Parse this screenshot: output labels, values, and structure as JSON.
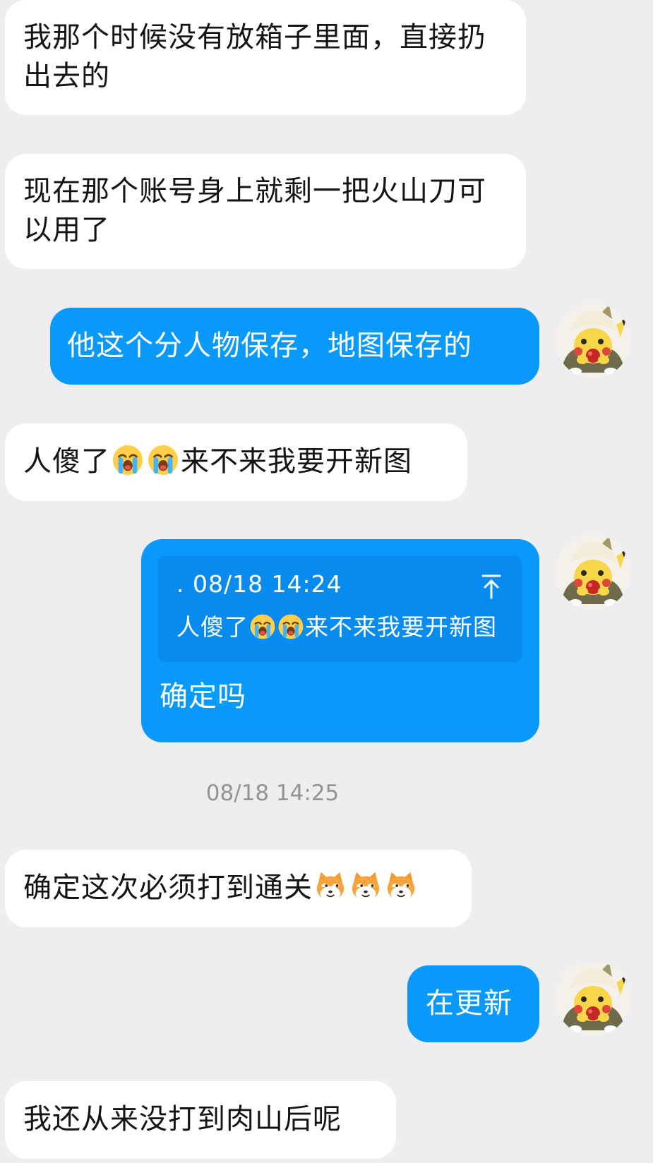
{
  "messages": {
    "m1": "我那个时候没有放箱子里面，直接扔出去的",
    "m2": "现在那个账号身上就剩一把火山刀可以用了",
    "m3": "他这个分人物保存，地图保存的",
    "m4_a": "人傻了",
    "m4_b": "来不来我要开新图",
    "m5_quote_meta": ". 08/18 14:24",
    "m5_quote_a": "人傻了",
    "m5_quote_b": "来不来我要开新图",
    "m5_reply": "确定吗",
    "m6": "确定这次必须打到通关",
    "m7": "在更新",
    "m8": "我还从来没打到肉山后呢"
  },
  "timestamp": "08/18 14:25",
  "icons": {
    "crying": "loudly-crying-face-emoji",
    "dog": "smirking-dog-emoji",
    "jump": "arrow-up-to-top-icon",
    "avatar": "pikachu-eating-avatar"
  },
  "colors": {
    "background": "#eeeef0",
    "incoming_bubble": "#ffffff",
    "outgoing_bubble": "#0899fb",
    "quote_box": "#078bee"
  }
}
